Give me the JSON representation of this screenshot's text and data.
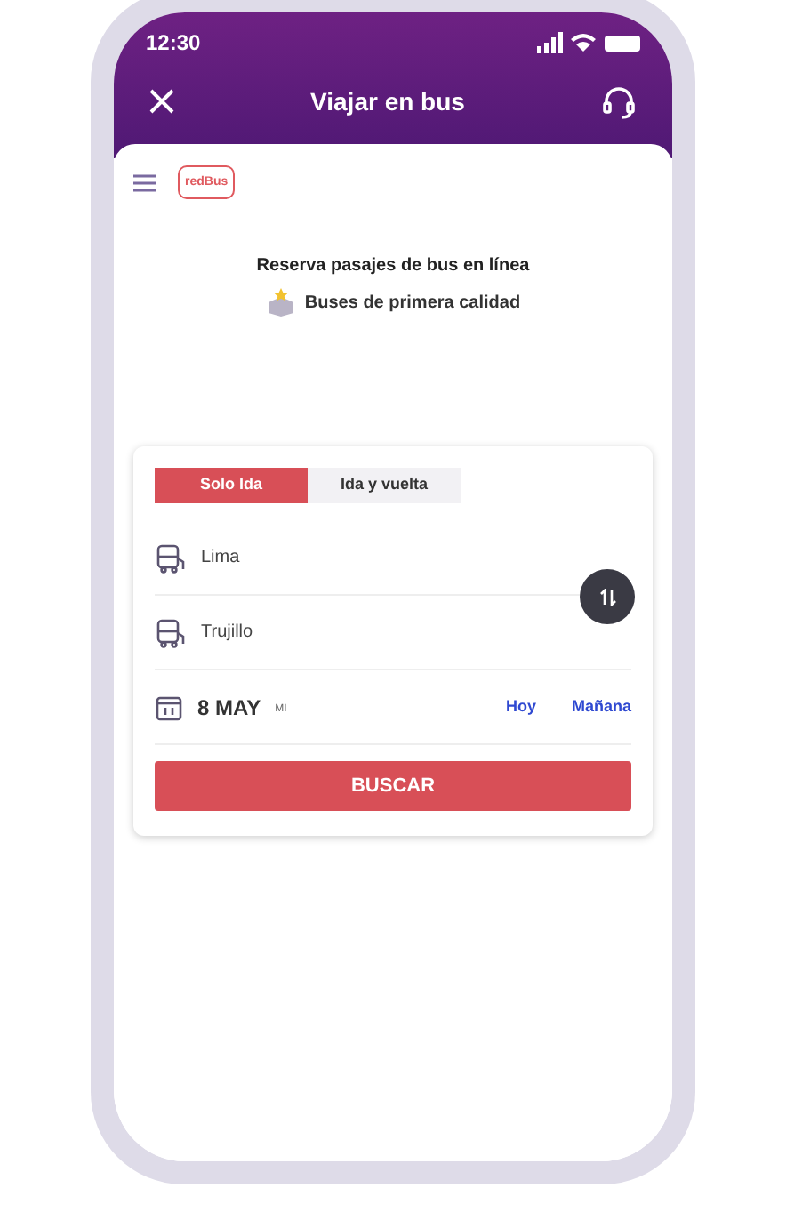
{
  "status_bar": {
    "time": "12:30"
  },
  "header": {
    "title": "Viajar en bus"
  },
  "logo": {
    "text": "redBus"
  },
  "hero": {
    "headline": "Reserva pasajes de bus en línea",
    "feature": "Buses de primera calidad"
  },
  "trip_tabs": [
    {
      "label": "Solo Ida",
      "selected": true
    },
    {
      "label": "Ida y vuelta",
      "selected": false
    }
  ],
  "origin": {
    "value": "Lima"
  },
  "destination": {
    "value": "Trujillo"
  },
  "date": {
    "value": "8 MAY",
    "weekday": "MI",
    "shortcuts": [
      "Hoy",
      "Mañana"
    ]
  },
  "search_button": "BUSCAR"
}
